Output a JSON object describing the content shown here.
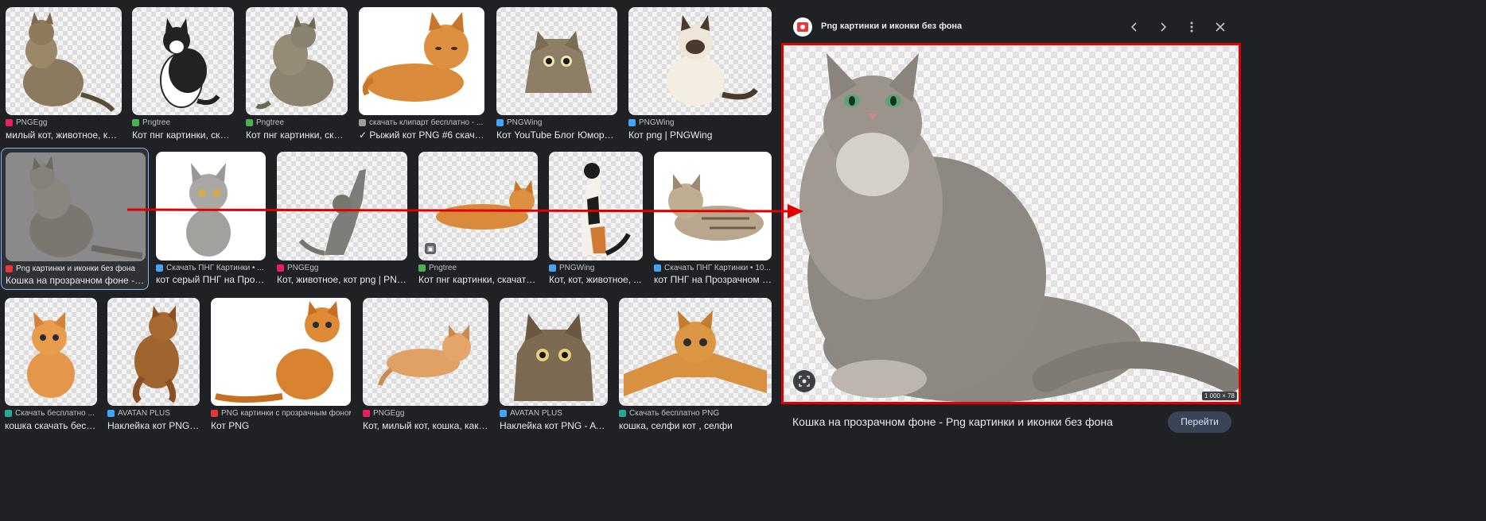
{
  "results": {
    "row1": [
      {
        "source": "PNGEgg",
        "caption": "милый кот, животное, кот ...",
        "fav_color": "#e91e63"
      },
      {
        "source": "Pngtree",
        "caption": "Кот пнг картинки, скач...",
        "fav_color": "#4caf50"
      },
      {
        "source": "Pngtree",
        "caption": "Кот пнг картинки, скач...",
        "fav_color": "#4caf50"
      },
      {
        "source": "скачать клипарт бесплатно - ...",
        "caption": "✓ Рыжий кот PNG #6 скачат...",
        "fav_color": "#9e9e9e"
      },
      {
        "source": "PNGWing",
        "caption": "Кот YouTube Блог Юмора Р...",
        "fav_color": "#42a5f5"
      },
      {
        "source": "PNGWing",
        "caption": "Кот png | PNGWing",
        "fav_color": "#42a5f5"
      }
    ],
    "row2": [
      {
        "source": "Png картинки и иконки без фона",
        "caption": "Кошка на прозрачном фоне - Р...",
        "fav_color": "#e53935"
      },
      {
        "source": "Скачать ПНГ Картинки • ...",
        "caption": "кот серый ПНГ на Прозр...",
        "fav_color": "#42a5f5"
      },
      {
        "source": "PNGEgg",
        "caption": "Кот, животное, кот png | PNG...",
        "fav_color": "#e91e63"
      },
      {
        "source": "Pngtree",
        "caption": "Кот пнг картинки, скачать ...",
        "fav_color": "#4caf50"
      },
      {
        "source": "PNGWing",
        "caption": "Кот, кот, животное, ...",
        "fav_color": "#42a5f5"
      },
      {
        "source": "Скачать ПНГ Картинки • 10...",
        "caption": "кот ПНГ на Прозрачном Ф...",
        "fav_color": "#42a5f5"
      }
    ],
    "row3": [
      {
        "source": "Скачать бесплатно ...",
        "caption": "кошка скачать бесп...",
        "fav_color": "#26a69a"
      },
      {
        "source": "AVATAN PLUS",
        "caption": "Наклейка кот PNG -...",
        "fav_color": "#42a5f5"
      },
      {
        "source": "PNG картинки с прозрачным фоном",
        "caption": "Кот PNG",
        "fav_color": "#e53935"
      },
      {
        "source": "PNGEgg",
        "caption": "Кот, милый кот, кошка, как м...",
        "fav_color": "#e91e63"
      },
      {
        "source": "AVATAN PLUS",
        "caption": "Наклейка кот PNG - AVA...",
        "fav_color": "#42a5f5"
      },
      {
        "source": "Скачать бесплатно PNG",
        "caption": "кошка, селфи кот , селфи",
        "fav_color": "#26a69a"
      }
    ]
  },
  "preview": {
    "site_name": "Png картинки и иконки без фона",
    "caption": "Кошка на прозрачном фоне - Png картинки и иконки без фона",
    "dimensions": "1 000 × 78",
    "visit_label": "Перейти",
    "accent_red": "#e00000"
  },
  "icons": {
    "prev": "chevron-left-icon",
    "next": "chevron-right-icon",
    "more": "more-vert-icon",
    "close": "close-icon",
    "lens": "lens-icon",
    "image_badge": "image-badge-icon"
  }
}
